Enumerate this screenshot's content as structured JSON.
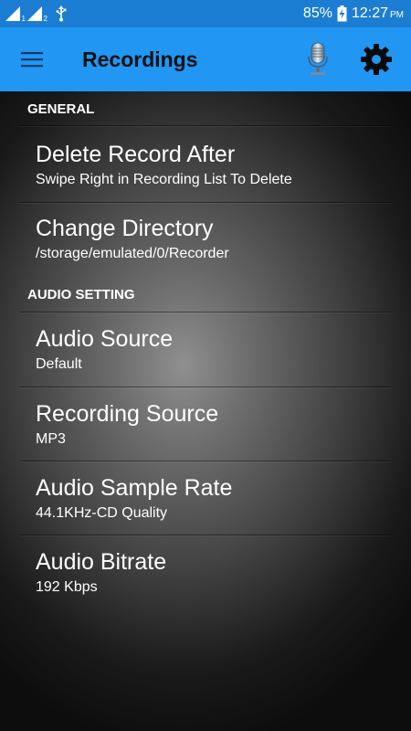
{
  "status_bar": {
    "sim1": "1",
    "sim2": "2",
    "battery_percent": "85%",
    "time": "12:27",
    "ampm": "PM"
  },
  "app_bar": {
    "title": "Recordings",
    "menu_icon": "hamburger-menu-icon",
    "mic_icon": "microphone-icon",
    "settings_icon": "gear-icon"
  },
  "sections": [
    {
      "header": "GENERAL",
      "items": [
        {
          "title": "Delete Record After",
          "summary": "Swipe Right in Recording List To Delete"
        },
        {
          "title": "Change Directory",
          "summary": "/storage/emulated/0/Recorder"
        }
      ]
    },
    {
      "header": "AUDIO SETTING",
      "items": [
        {
          "title": "Audio Source",
          "summary": "Default"
        },
        {
          "title": "Recording Source",
          "summary": "MP3"
        },
        {
          "title": "Audio Sample Rate",
          "summary": "44.1KHz-CD Quality"
        },
        {
          "title": "Audio Bitrate",
          "summary": "192 Kbps"
        }
      ]
    }
  ],
  "colors": {
    "status_bar": "#1c7ed2",
    "app_bar": "#2196f3",
    "title_text": "#111111",
    "pref_text": "#ffffff"
  }
}
